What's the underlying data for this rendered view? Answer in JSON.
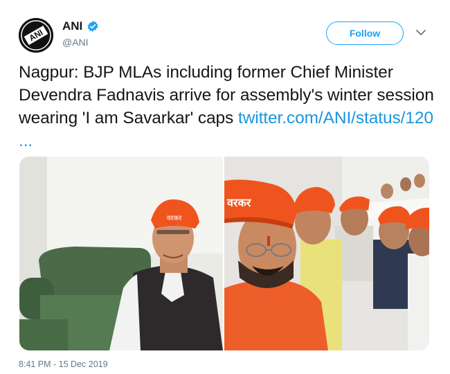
{
  "account": {
    "display_name": "ANI",
    "handle": "@ANI",
    "avatar_text": "ANI",
    "verified": true
  },
  "follow_label": "Follow",
  "tweet": {
    "text": "Nagpur: BJP MLAs including former Chief Minister Devendra Fadnavis arrive for assembly's winter session wearing 'I am Savarkar' caps ",
    "link": "twitter.com/ANI/status/120 ..."
  },
  "media": {
    "cap_text": "वरकर"
  },
  "timestamp": "8:41 PM - 15 Dec 2019",
  "colors": {
    "accent": "#1da1f2",
    "link": "#1b95e0",
    "secondary_text": "#657786",
    "cap_saffron": "#f0541e"
  }
}
